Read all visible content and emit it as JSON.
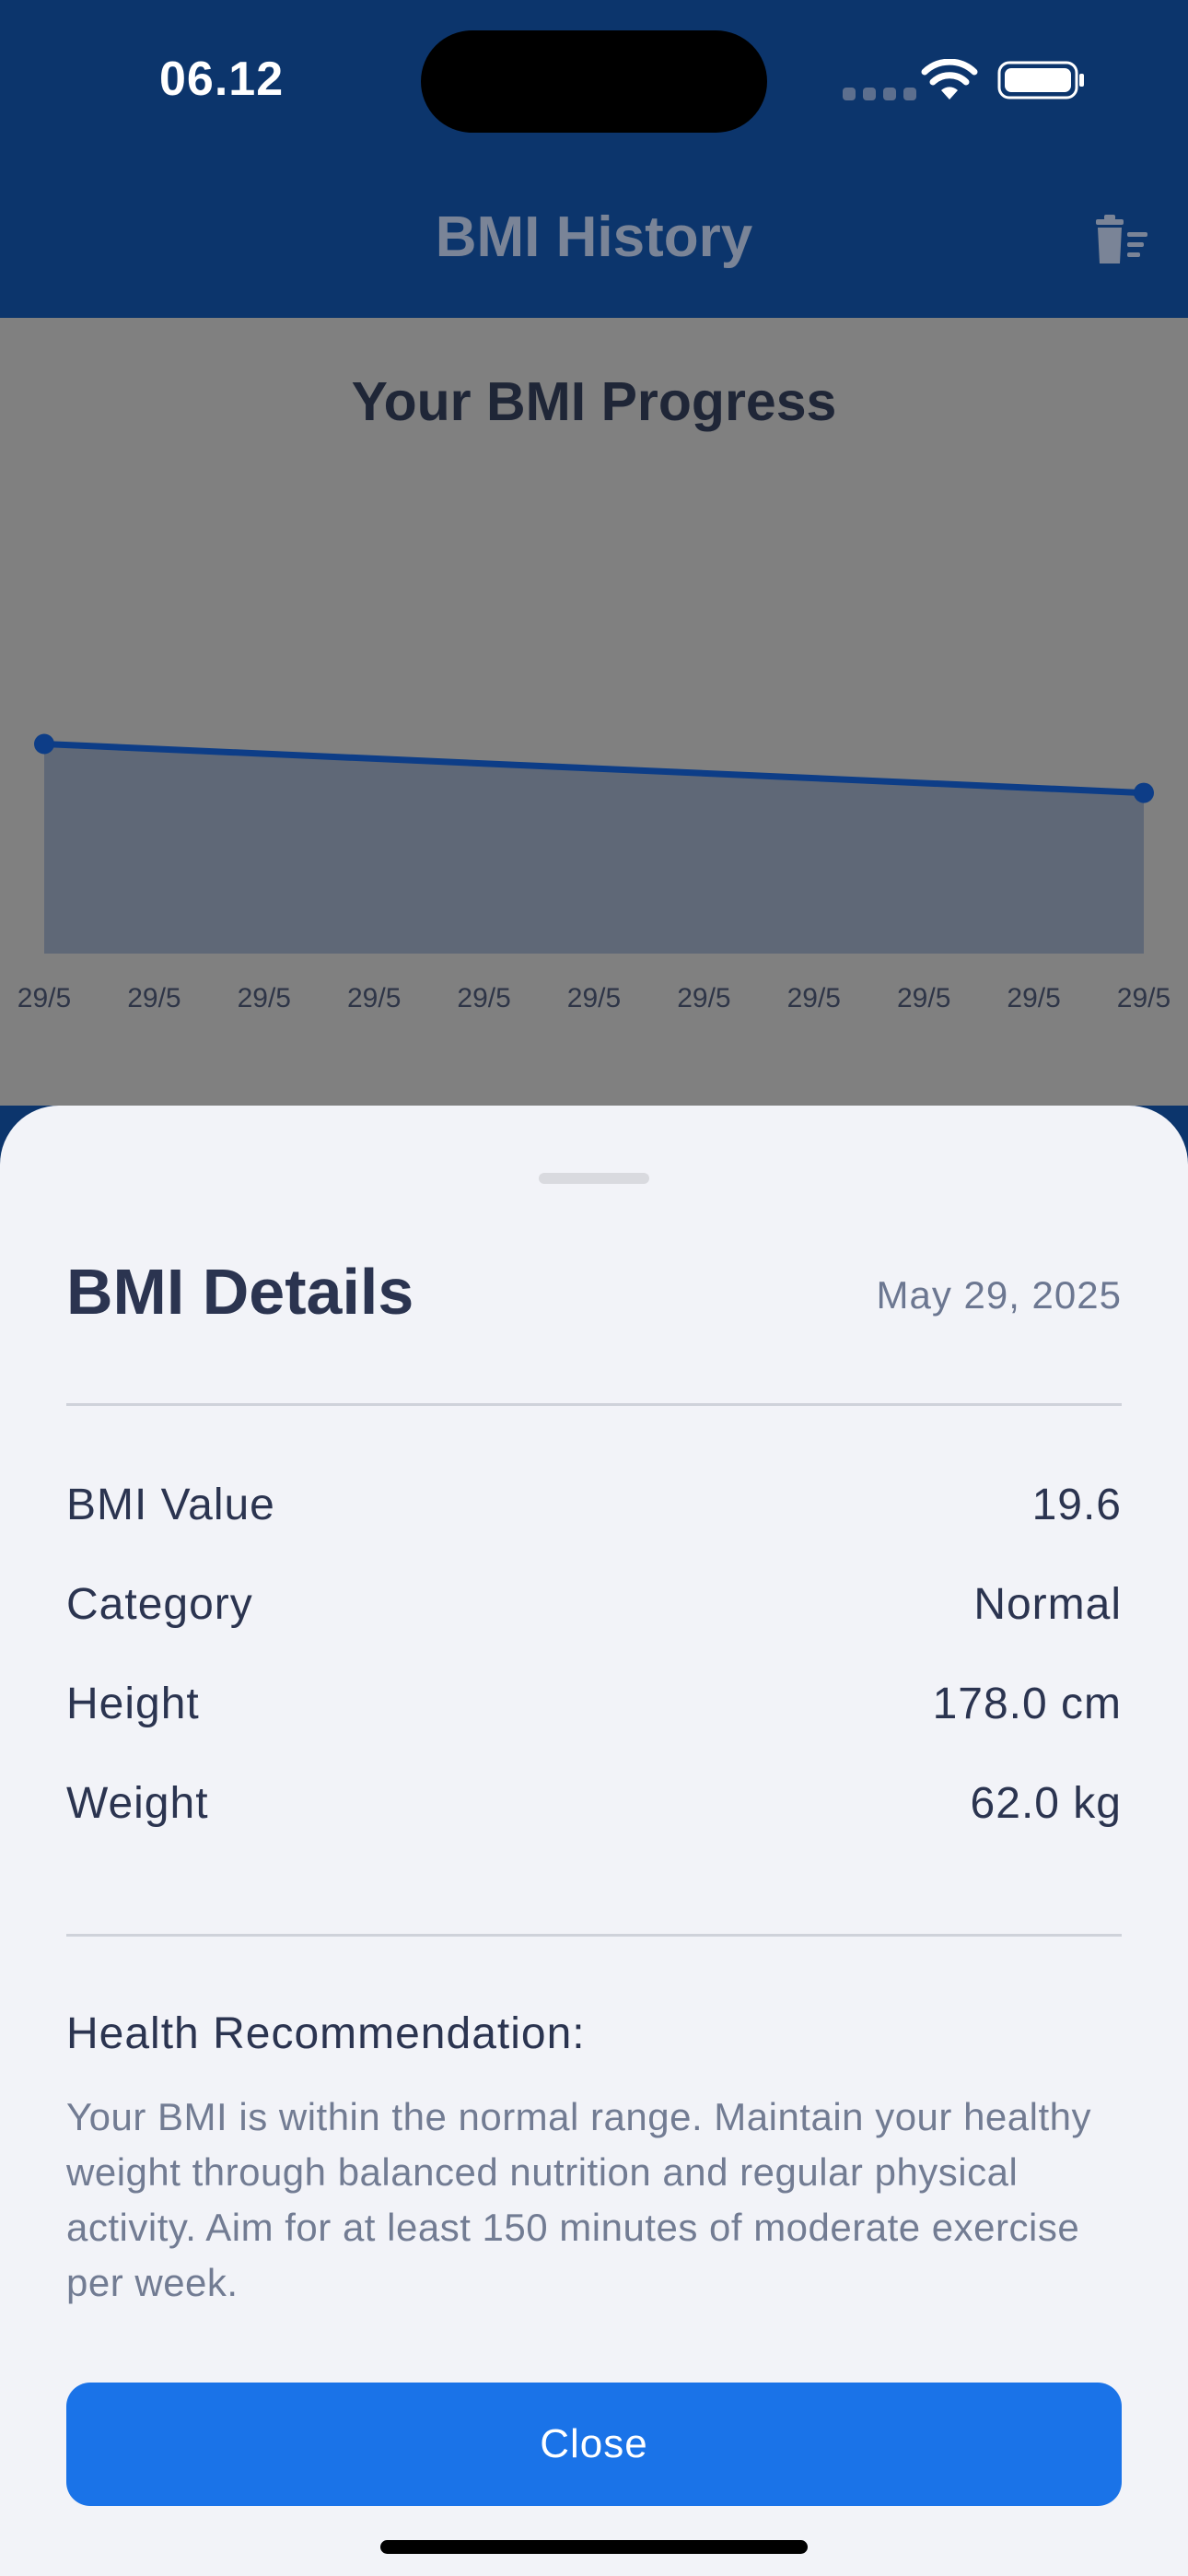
{
  "status_bar": {
    "time": "06.12",
    "wifi_icon": "wifi-icon",
    "battery_icon": "battery-icon"
  },
  "header": {
    "title": "BMI History",
    "trash_icon": "trash-icon"
  },
  "chart_data": {
    "type": "area",
    "title": "Your BMI Progress",
    "categories": [
      "29/5",
      "29/5",
      "29/5",
      "29/5",
      "29/5",
      "29/5",
      "29/5",
      "29/5",
      "29/5",
      "29/5",
      "29/5"
    ],
    "series": [
      {
        "points": [
          {
            "index": 0,
            "value": 21.0
          },
          {
            "index": 10,
            "value": 19.6
          }
        ]
      }
    ],
    "ylim": [
      15,
      27
    ],
    "line_color": "#0d3d87",
    "fill_color": "#5f6877"
  },
  "sheet": {
    "title": "BMI Details",
    "date": "May 29, 2025",
    "rows": [
      {
        "label": "BMI Value",
        "value": "19.6"
      },
      {
        "label": "Category",
        "value": "Normal"
      },
      {
        "label": "Height",
        "value": "178.0 cm"
      },
      {
        "label": "Weight",
        "value": "62.0 kg"
      }
    ],
    "recommendation_heading": "Health Recommendation:",
    "recommendation_text": "Your BMI is within the normal range. Maintain your healthy weight through balanced nutrition and regular physical activity. Aim for at least 150 minutes of moderate exercise per week.",
    "close_label": "Close"
  },
  "colors": {
    "header_bg": "#0c356c",
    "accent": "#1a73e8",
    "sheet_bg": "#f2f3f8",
    "overlay": "#808080"
  }
}
